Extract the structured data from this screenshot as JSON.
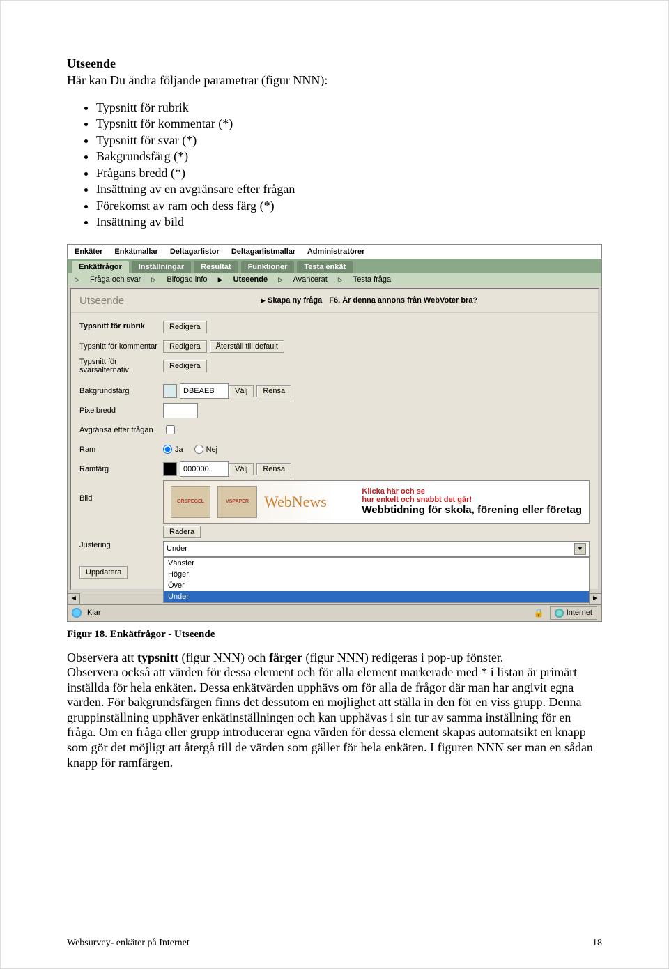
{
  "doc": {
    "heading": "Utseende",
    "intro": "Här kan Du ändra följande parametrar (figur NNN):",
    "bullets": [
      "Typsnitt för rubrik",
      "Typsnitt för kommentar (*)",
      "Typsnitt för svar (*)",
      "Bakgrundsfärg (*)",
      "Frågans bredd (*)",
      "Insättning av en avgränsare efter frågan",
      "Förekomst av ram och dess färg (*)",
      "Insättning av bild"
    ],
    "caption": "Figur 18. Enkätfrågor - Utseende",
    "para1a": "Observera att ",
    "para1b": "typsnitt",
    "para1c": " (figur NNN) och ",
    "para1d": "färger",
    "para1e": " (figur NNN) redigeras i pop-up fönster.",
    "para2": "Observera också att värden för dessa element och för alla element markerade med * i listan är primärt inställda för hela enkäten. Dessa enkätvärden upphävs om för alla de frågor där man har angivit egna värden. För bakgrundsfärgen finns det dessutom en möjlighet att ställa in den för en viss grupp. Denna gruppinställning upphäver enkätinställningen och kan upphävas i sin tur av samma inställning för en fråga. Om en fråga eller grupp introducerar egna värden för dessa element skapas automatsikt en knapp som gör det möjligt att återgå till de värden som gäller för hela enkäten. I figuren NNN ser man en sådan knapp för ramfärgen.",
    "footer_left": "Websurvey- enkäter på Internet",
    "footer_right": "18"
  },
  "ui": {
    "menu": [
      "Enkäter",
      "Enkätmallar",
      "Deltagarlistor",
      "Deltagarlistmallar",
      "Administratörer"
    ],
    "tabs": [
      "Enkätfrågor",
      "Inställningar",
      "Resultat",
      "Funktioner",
      "Testa enkät"
    ],
    "subtabs": [
      "Fråga och svar",
      "Bifogad info",
      "Utseende",
      "Avancerat",
      "Testa fråga"
    ],
    "panel_title": "Utseende",
    "new_q": "Skapa ny fråga",
    "q_text": "F6. Är denna annons från WebVoter bra?",
    "rows": {
      "r1": "Typsnitt för rubrik",
      "r2": "Typsnitt för kommentar",
      "r3": "Typsnitt för svarsalternativ",
      "r4": "Bakgrundsfärg",
      "r5": "Pixelbredd",
      "r6": "Avgränsa efter frågan",
      "r7": "Ram",
      "r8": "Ramfärg",
      "r9": "Bild",
      "r10": "Justering"
    },
    "btn": {
      "redigera": "Redigera",
      "aterstall": "Återställ till default",
      "valj": "Välj",
      "rensa": "Rensa",
      "radera": "Radera",
      "uppdatera": "Uppdatera"
    },
    "vals": {
      "bg_color": "DBEAEB",
      "ram_color": "000000",
      "ram_ja": "Ja",
      "ram_nej": "Nej",
      "just_sel": "Under",
      "just_opts": [
        "Vänster",
        "Höger",
        "Över",
        "Under"
      ]
    },
    "banner": {
      "thumb1": "ORSPEGEL",
      "thumb2": "VSPAPER",
      "title": "WebNews",
      "red1": "Klicka här och se",
      "red2": "hur enkelt och snabbt det går!",
      "sub": "Webbtidning för skola, förening eller företag"
    },
    "status": {
      "klar": "Klar",
      "zone": "Internet"
    }
  }
}
